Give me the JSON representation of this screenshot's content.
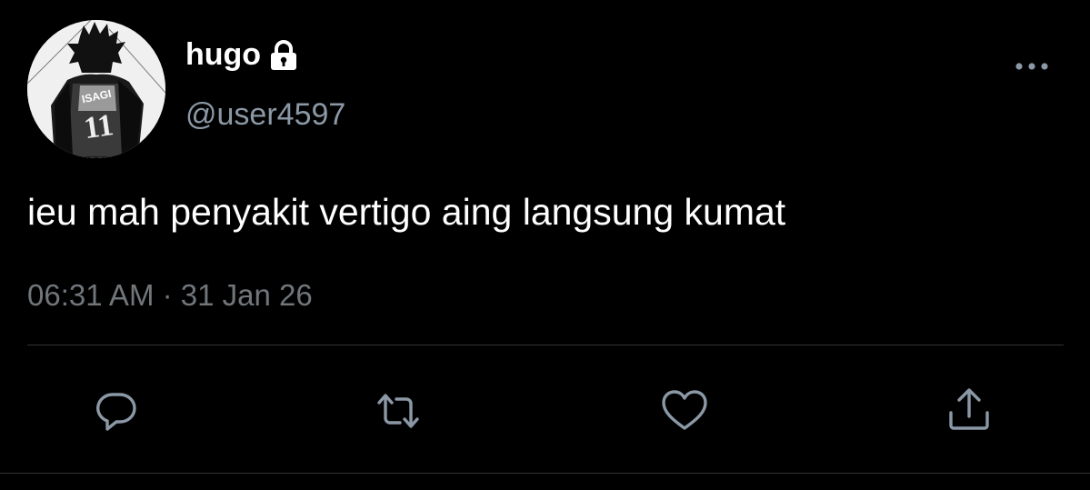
{
  "user": {
    "display_name": "hugo",
    "handle": "@user4597",
    "protected_icon": "lock-icon",
    "avatar_text": {
      "jersey_name": "ISAGI",
      "jersey_number": "11"
    }
  },
  "tweet": {
    "text": "ieu mah penyakit vertigo aing langsung kumat",
    "time": "06:31 AM",
    "separator": "·",
    "date": "31 Jan 26"
  },
  "actions": [
    {
      "icon": "reply-icon"
    },
    {
      "icon": "retweet-icon"
    },
    {
      "icon": "like-icon"
    },
    {
      "icon": "share-icon"
    }
  ],
  "more_icon": "more-icon",
  "colors": {
    "background": "#000000",
    "primary_text": "#ffffff",
    "secondary_text": "#71767b",
    "handle_text": "#8b98a5",
    "icon": "#8b98a5",
    "divider": "#2f3336"
  }
}
